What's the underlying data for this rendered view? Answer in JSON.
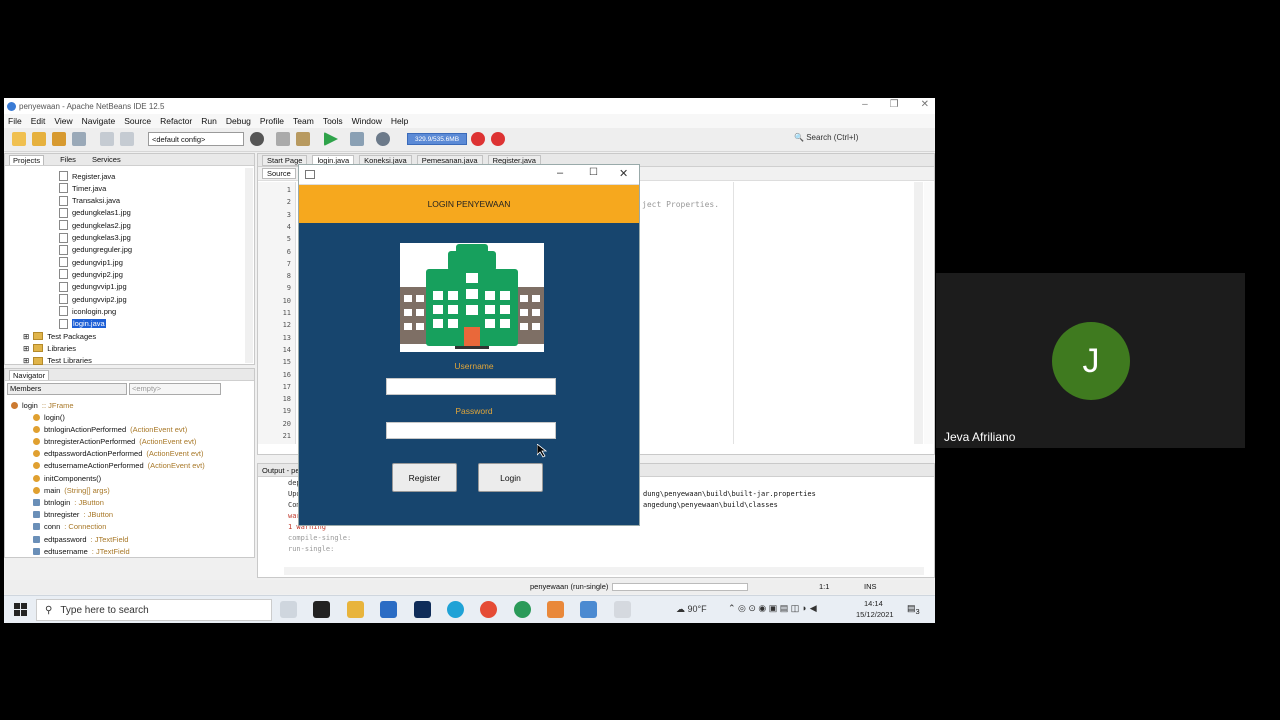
{
  "window": {
    "title": "penyewaan - Apache NetBeans IDE 12.5"
  },
  "menu": [
    "File",
    "Edit",
    "View",
    "Navigate",
    "Source",
    "Refactor",
    "Run",
    "Debug",
    "Profile",
    "Team",
    "Tools",
    "Window",
    "Help"
  ],
  "toolbar": {
    "config": "<default config>",
    "memory": "329.9/535.6MB",
    "search_placeholder": "Search (Ctrl+I)"
  },
  "projects_panel": {
    "tabs": [
      "Projects",
      "Files",
      "Services"
    ],
    "files": [
      "Register.java",
      "Timer.java",
      "Transaksi.java",
      "gedungkelas1.jpg",
      "gedungkelas2.jpg",
      "gedungkelas3.jpg",
      "gedungreguler.jpg",
      "gedungvip1.jpg",
      "gedungvip2.jpg",
      "gedungvvip1.jpg",
      "gedungvvip2.jpg",
      "iconlogin.png",
      "login.java"
    ],
    "folders": [
      "Test Packages",
      "Libraries",
      "Test Libraries"
    ]
  },
  "navigator_panel": {
    "title": "Navigator",
    "filter": "Members",
    "empty": "<empty>",
    "root": {
      "name": "login",
      "type": " :: JFrame"
    },
    "members": [
      {
        "name": "login()",
        "type": ""
      },
      {
        "name": "btnloginActionPerformed",
        "type": "(ActionEvent evt)"
      },
      {
        "name": "btnregisterActionPerformed",
        "type": "(ActionEvent evt)"
      },
      {
        "name": "edtpasswordActionPerformed",
        "type": "(ActionEvent evt)"
      },
      {
        "name": "edtusernameActionPerformed",
        "type": "(ActionEvent evt)"
      },
      {
        "name": "initComponents()",
        "type": ""
      },
      {
        "name": "main",
        "type": "(String[] args)"
      },
      {
        "name": "btnlogin",
        "type": " : JButton"
      },
      {
        "name": "btnregister",
        "type": " : JButton"
      },
      {
        "name": "conn",
        "type": " : Connection"
      },
      {
        "name": "edtpassword",
        "type": " : JTextField"
      },
      {
        "name": "edtusername",
        "type": " : JTextField"
      }
    ]
  },
  "editor": {
    "tabs": [
      "Start Page",
      "login.java",
      "Koneksi.java",
      "Pemesanan.java",
      "Register.java"
    ],
    "source_tab": "Source",
    "line_numbers": [
      "1",
      "2",
      "3",
      "4",
      "5",
      "6",
      "7",
      "8",
      "9",
      "10",
      "11",
      "12",
      "13",
      "14",
      "15",
      "16",
      "17",
      "18",
      "19",
      "20",
      "21"
    ],
    "code_fragment": "ject Properties."
  },
  "output": {
    "title": "Output - pe",
    "lines": [
      "dep",
      "Upd",
      "Com",
      "war",
      "1 warning",
      "compile-single:",
      "run-single:"
    ],
    "right_lines": [
      "dung\\penyewaan\\build\\built-jar.properties",
      "angedung\\penyewaan\\build\\classes"
    ]
  },
  "status": {
    "task": "penyewaan (run-single)",
    "position": "1:1",
    "mode": "INS"
  },
  "taskbar": {
    "search_placeholder": "Type here to search",
    "weather": "90°F",
    "time": "14:14",
    "date": "15/12/2021",
    "notif": "3"
  },
  "dialog": {
    "header": "LOGIN PENYEWAAN",
    "username_label": "Username",
    "password_label": "Password",
    "register_label": "Register",
    "login_label": "Login"
  },
  "participant": {
    "initial": "J",
    "name": "Jeva Afriliano"
  },
  "colors": {
    "dialog_bg": "#17456e",
    "header": "#f6a81e",
    "avatar": "#3f7a1f",
    "label": "#e0a53a"
  }
}
